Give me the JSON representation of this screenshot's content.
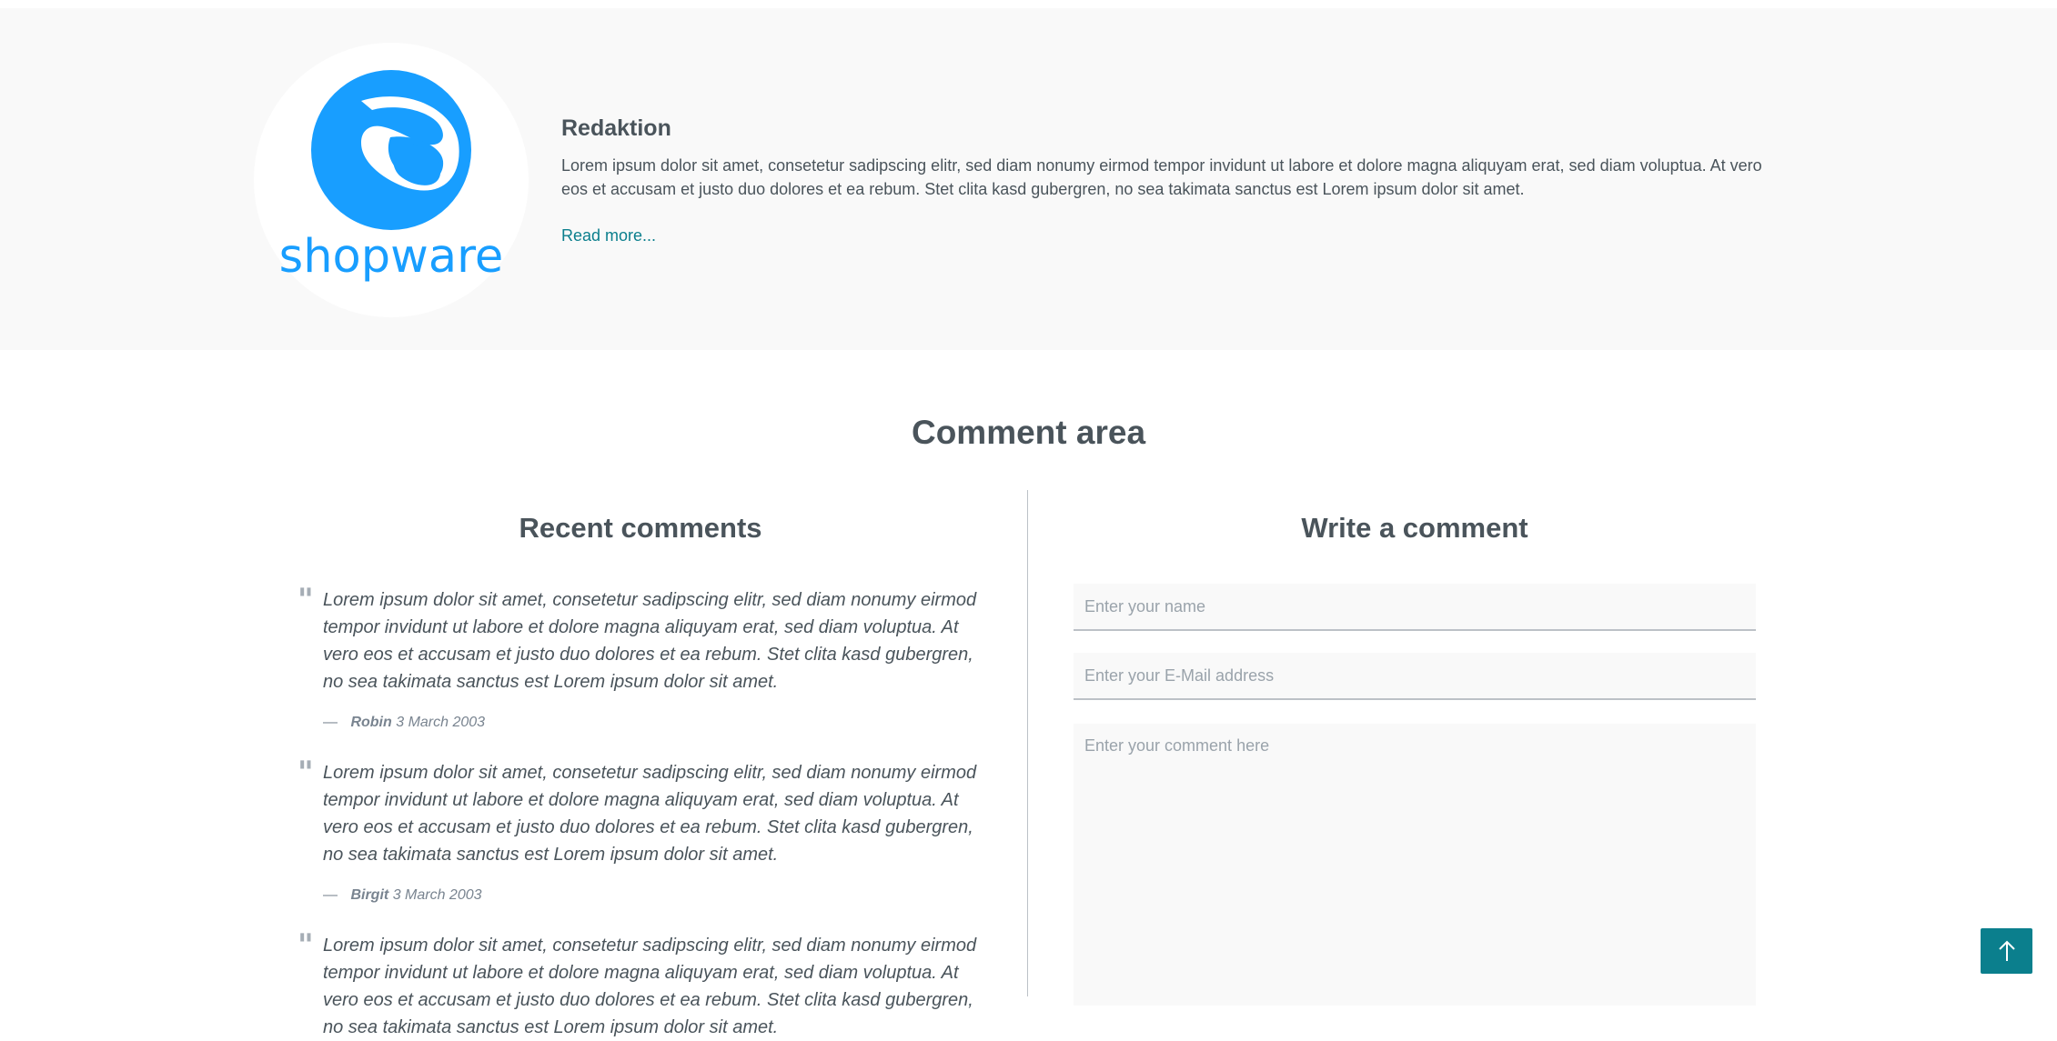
{
  "author": {
    "logo_text": "shopware",
    "name": "Redaktion",
    "bio": "Lorem ipsum dolor sit amet, consetetur sadipscing elitr, sed diam nonumy eirmod tempor invidunt ut labore et dolore magna aliquyam erat, sed diam voluptua. At vero eos et accusam et justo duo dolores et ea rebum. Stet clita kasd gubergren, no sea takimata sanctus est Lorem ipsum dolor sit amet.",
    "read_more": "Read more..."
  },
  "comment_area": {
    "title": "Comment area",
    "recent_title": "Recent comments",
    "write_title": "Write a comment",
    "comments": [
      {
        "text": "Lorem ipsum dolor sit amet, consetetur sadipscing elitr, sed diam nonumy eirmod tempor invidunt ut labore et dolore magna aliquyam erat, sed diam voluptua. At vero eos et accusam et justo duo dolores et ea rebum. Stet clita kasd gubergren, no sea takimata sanctus est Lorem ipsum dolor sit amet.",
        "dash": "—",
        "author": "Robin",
        "date": "3 March 2003"
      },
      {
        "text": "Lorem ipsum dolor sit amet, consetetur sadipscing elitr, sed diam nonumy eirmod tempor invidunt ut labore et dolore magna aliquyam erat, sed diam voluptua. At vero eos et accusam et justo duo dolores et ea rebum. Stet clita kasd gubergren, no sea takimata sanctus est Lorem ipsum dolor sit amet.",
        "dash": "—",
        "author": "Birgit",
        "date": "3 March 2003"
      },
      {
        "text": "Lorem ipsum dolor sit amet, consetetur sadipscing elitr, sed diam nonumy eirmod tempor invidunt ut labore et dolore magna aliquyam erat, sed diam voluptua. At vero eos et accusam et justo duo dolores et ea rebum. Stet clita kasd gubergren, no sea takimata sanctus est Lorem ipsum dolor sit amet.",
        "dash": "",
        "author": "",
        "date": ""
      }
    ],
    "form": {
      "name_placeholder": "Enter your name",
      "email_placeholder": "Enter your E-Mail address",
      "comment_placeholder": "Enter your comment here"
    }
  },
  "icons": {
    "quote": "quote-icon",
    "back_to_top": "arrow-up-icon",
    "logo": "shopware-logo"
  },
  "colors": {
    "accent": "#0b7f8d",
    "logo_blue": "#189eff",
    "text": "#4a545b",
    "panel": "#f9f9f9"
  }
}
